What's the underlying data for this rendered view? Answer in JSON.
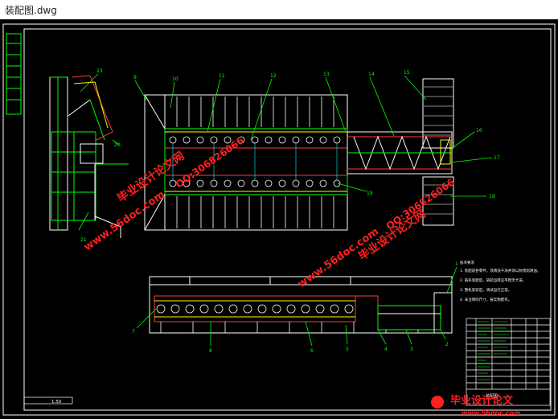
{
  "window": {
    "title": "装配图.dwg"
  },
  "drawing": {
    "part_numbers_top": [
      "23",
      "9",
      "10",
      "11",
      "12",
      "13",
      "14",
      "15",
      "16",
      "17",
      "18",
      "19",
      "20",
      "21",
      "22"
    ],
    "part_numbers_bottom": [
      "7",
      "8",
      "6",
      "5",
      "4",
      "3",
      "2",
      "1"
    ],
    "scale_label": "1:50",
    "notes_title": "技术要求",
    "notes": [
      "1. 装配前各零件，须清洗干净并涂以防锈润滑油。",
      "2. 链条装配后，链轮运转应平稳无卡滞。",
      "3. 整机安装后，调试运行正常。",
      "4. 未注明的尺寸，按实物配作。"
    ],
    "title_block_label": "装配图"
  },
  "watermarks": {
    "site_url": "www.56doc.com",
    "qq": "QQ:306826066",
    "brand": "毕业设计论文网",
    "corner_brand": "毕业设计论文",
    "corner_url": "www.56doc.com"
  },
  "colors": {
    "background": "#000000",
    "line_white": "#ffffff",
    "line_green": "#00ff00",
    "line_red": "#ff3b3b",
    "line_yellow": "#ffff00",
    "line_cyan": "#00ffff",
    "line_magenta": "#ff00ff",
    "watermark": "#ff2020"
  }
}
